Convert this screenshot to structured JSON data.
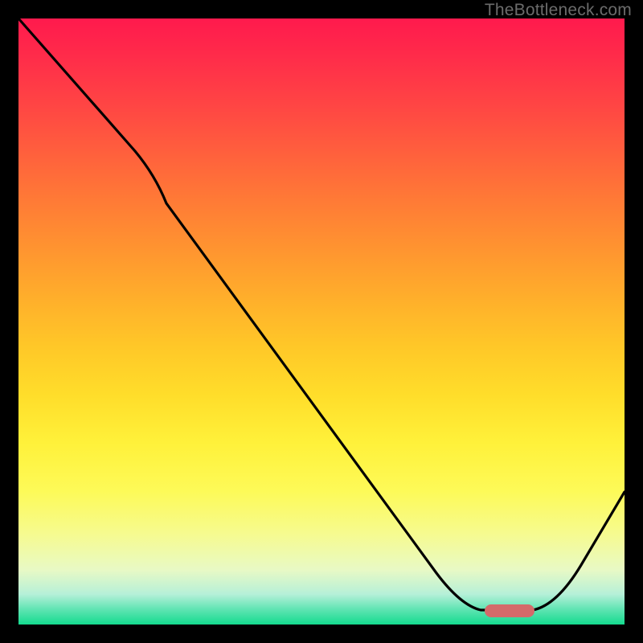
{
  "watermark": "TheBottleneck.com",
  "chart_data": {
    "type": "line",
    "title": "",
    "xlabel": "",
    "ylabel": "",
    "xlim": [
      0,
      100
    ],
    "ylim": [
      0,
      100
    ],
    "series": [
      {
        "name": "curve",
        "x": [
          0,
          10,
          20,
          30,
          40,
          50,
          60,
          70,
          75,
          80,
          85,
          90,
          100
        ],
        "y": [
          100,
          87,
          73,
          62,
          50,
          38,
          26,
          12,
          4,
          2,
          2,
          10,
          24
        ]
      }
    ],
    "marker": {
      "name": "highlight",
      "x_start": 77,
      "x_end": 85,
      "y": 2,
      "color": "#d46a6a"
    },
    "background_gradient": {
      "top": "#ff1a4d",
      "bottom": "#14db8e"
    }
  }
}
